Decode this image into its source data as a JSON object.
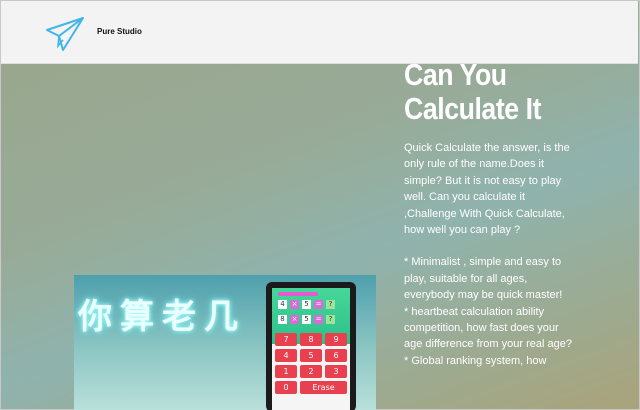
{
  "header": {
    "brand": "Pure Studio"
  },
  "hero": {
    "title_line1": "Can You",
    "title_line2": "Calculate It",
    "paragraphs": [
      "Quick Calculate the answer, is the only rule of the name.Does it simple? But it is not easy to play well. Can you calculate it ,Challenge With Quick Calculate, how well you can play ?",
      "* Minimalist , simple and easy to play, suitable for all ages, everybody may be quick master!",
      "* heartbeat calculation ability competition, how fast does your age difference from your real age?",
      "* Global ranking system, how"
    ]
  },
  "screenshot": {
    "banner_text": "你算老几",
    "rows": [
      [
        "4",
        "×",
        "5",
        "=",
        "?"
      ],
      [
        "8",
        "×",
        "5",
        "=",
        "?"
      ]
    ],
    "keys": [
      "7",
      "8",
      "9",
      "4",
      "5",
      "6",
      "1",
      "2",
      "3",
      "0",
      "Erase"
    ]
  },
  "colors": {
    "logo": "#3fb6e8",
    "key": "#e9404f",
    "game_green": "#46d79a"
  },
  "icons": {
    "logo": "paper-plane-icon"
  }
}
